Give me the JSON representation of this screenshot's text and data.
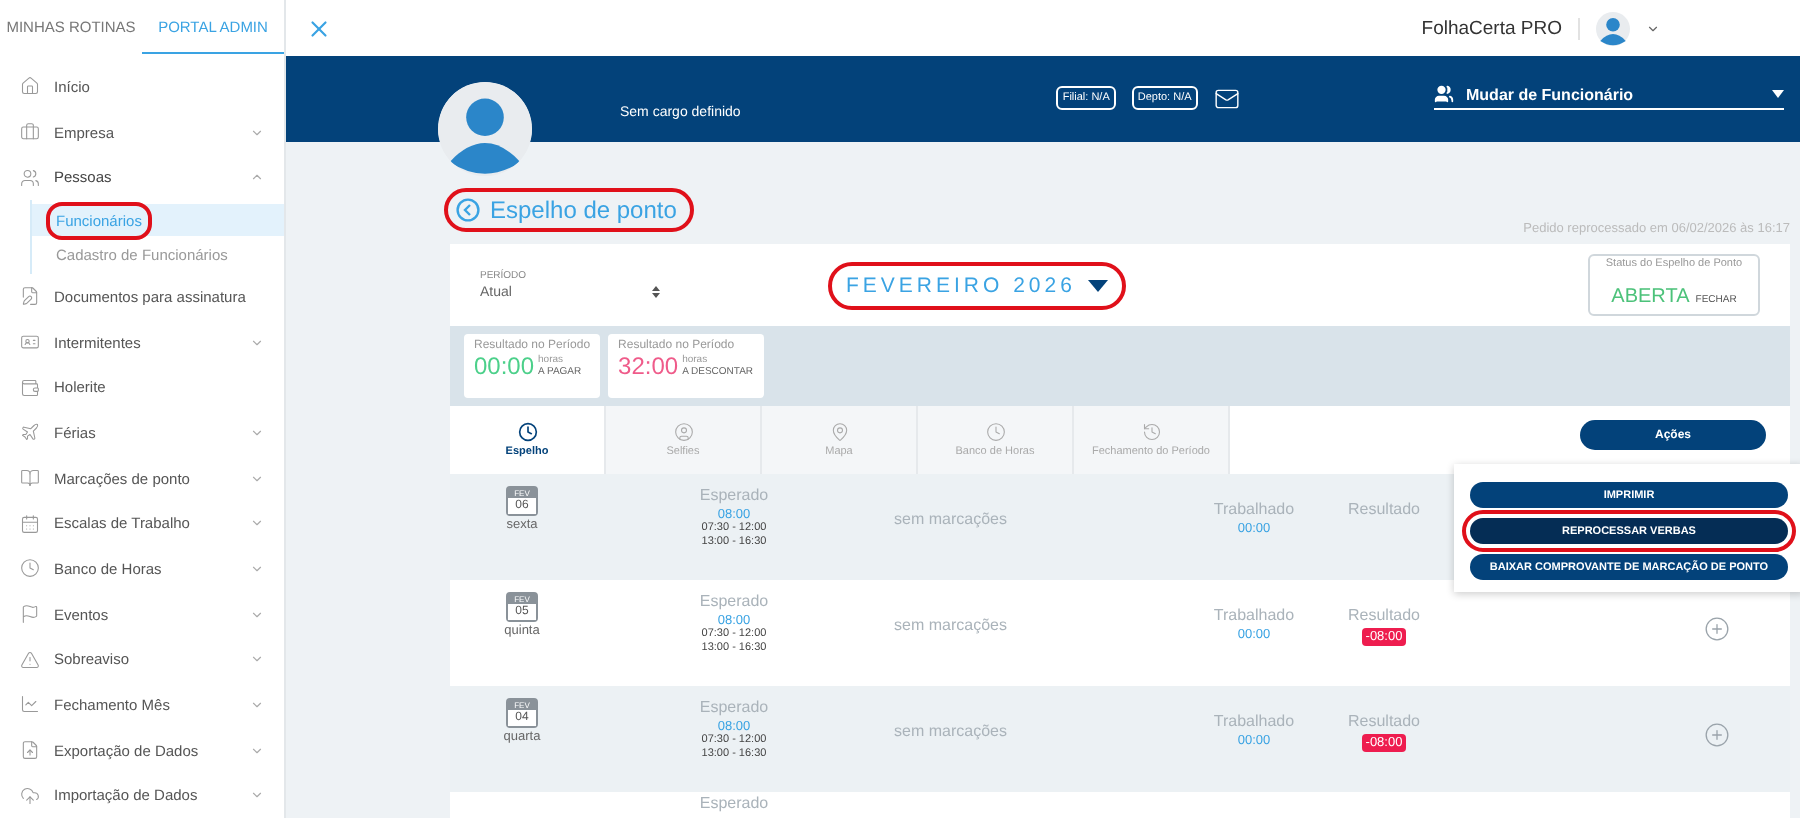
{
  "sidebar": {
    "tabs": [
      {
        "label": "MINHAS ROTINAS",
        "selected": false
      },
      {
        "label": "PORTAL ADMIN",
        "selected": true
      }
    ],
    "items": [
      {
        "label": "Início"
      },
      {
        "label": "Empresa",
        "expanded": false
      },
      {
        "label": "Pessoas",
        "expanded": true,
        "children": [
          {
            "label": "Funcionários",
            "selected": true,
            "highlighted": true
          },
          {
            "label": "Cadastro de Funcionários",
            "selected": false,
            "highlighted": false
          }
        ]
      },
      {
        "label": "Documentos para assinatura"
      },
      {
        "label": "Intermitentes",
        "expanded": false
      },
      {
        "label": "Holerite"
      },
      {
        "label": "Férias",
        "expanded": false
      },
      {
        "label": "Marcações de ponto",
        "expanded": false
      },
      {
        "label": "Escalas de Trabalho",
        "expanded": false
      },
      {
        "label": "Banco de Horas",
        "expanded": false
      },
      {
        "label": "Eventos",
        "expanded": false
      },
      {
        "label": "Sobreaviso",
        "expanded": false
      },
      {
        "label": "Fechamento Mês",
        "expanded": false
      },
      {
        "label": "Exportação de Dados",
        "expanded": false
      },
      {
        "label": "Importação de Dados",
        "expanded": false
      }
    ]
  },
  "topbar": {
    "product": "FolhaCerta PRO"
  },
  "employee": {
    "role": "Sem cargo definido",
    "filial": "Filial: N/A",
    "depto": "Depto: N/A",
    "switcher": "Mudar de Funcionário"
  },
  "page": {
    "title": "Espelho de ponto",
    "title_highlighted": true,
    "reprocessed": "Pedido reprocessado em 06/02/2026 às 16:17"
  },
  "period": {
    "label": "PERÍODO",
    "value": "Atual",
    "month": "FEVEREIRO 2026",
    "month_highlighted": true
  },
  "status": {
    "label": "Status do Espelho de Ponto",
    "value": "ABERTA",
    "action": "FECHAR"
  },
  "results": [
    {
      "label": "Resultado no Período",
      "value": "00:00",
      "unit": "horas",
      "caption": "A PAGAR",
      "kind": "credit"
    },
    {
      "label": "Resultado no Período",
      "value": "32:00",
      "unit": "horas",
      "caption": "A DESCONTAR",
      "kind": "debit"
    }
  ],
  "tabs": [
    {
      "label": "Espelho",
      "selected": true
    },
    {
      "label": "Selfies",
      "selected": false
    },
    {
      "label": "Mapa",
      "selected": false
    },
    {
      "label": "Banco de Horas",
      "selected": false
    },
    {
      "label": "Fechamento do Período",
      "selected": false
    }
  ],
  "actions": {
    "label": "Ações",
    "expanded": true,
    "menu": [
      {
        "label": "IMPRIMIR",
        "highlighted": false
      },
      {
        "label": "REPROCESSAR VERBAS",
        "highlighted": true
      },
      {
        "label": "BAIXAR COMPROVANTE DE MARCAÇÃO DE PONTO",
        "highlighted": false
      }
    ]
  },
  "rows": [
    {
      "month": "FEV",
      "day": "06",
      "weekday": "sexta",
      "expected_label": "Esperado",
      "expected": "08:00",
      "schedule": [
        "07:30 - 12:00",
        "13:00 - 16:30"
      ],
      "marks": "sem marcações",
      "worked_label": "Trabalhado",
      "worked": "00:00",
      "result_label": "Resultado"
    },
    {
      "month": "FEV",
      "day": "05",
      "weekday": "quinta",
      "expected_label": "Esperado",
      "expected": "08:00",
      "schedule": [
        "07:30 - 12:00",
        "13:00 - 16:30"
      ],
      "marks": "sem marcações",
      "worked_label": "Trabalhado",
      "worked": "00:00",
      "result_label": "Resultado",
      "result": "-08:00",
      "add": true
    },
    {
      "month": "FEV",
      "day": "04",
      "weekday": "quarta",
      "expected_label": "Esperado",
      "expected": "08:00",
      "schedule": [
        "07:30 - 12:00",
        "13:00 - 16:30"
      ],
      "marks": "sem marcações",
      "worked_label": "Trabalhado",
      "worked": "00:00",
      "result_label": "Resultado",
      "result": "-08:00",
      "add": true
    },
    {
      "expected_label": "Esperado"
    }
  ]
}
